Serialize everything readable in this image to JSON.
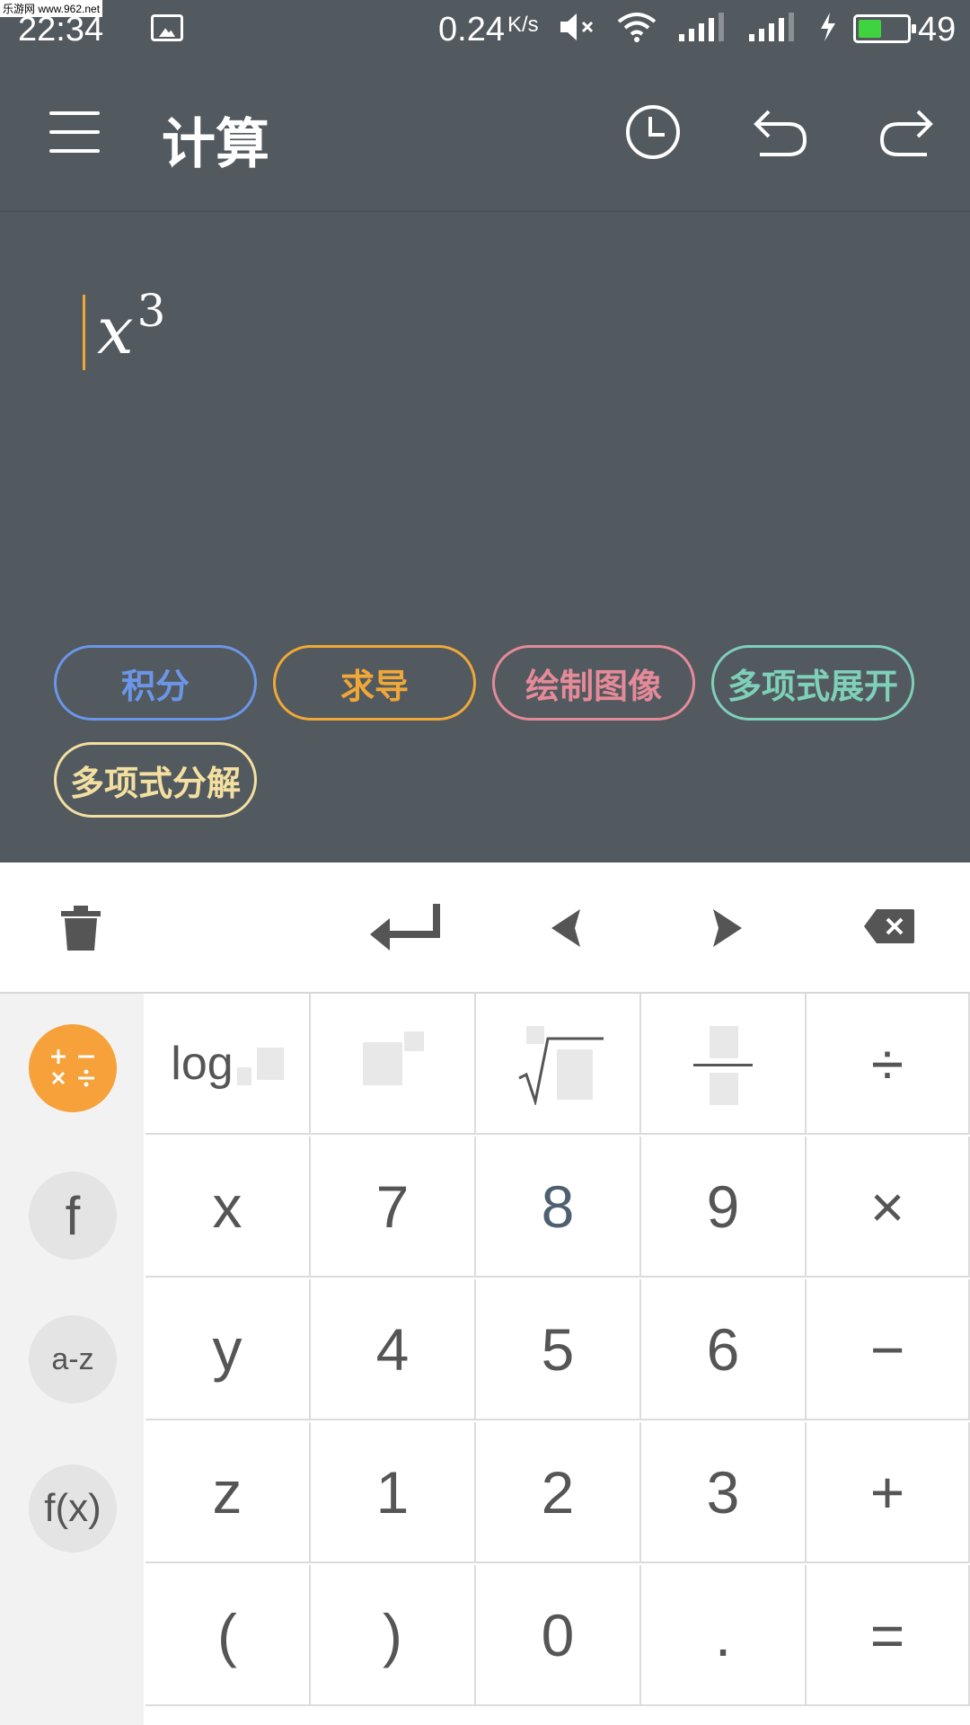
{
  "status_bar": {
    "time": "22:34",
    "speed": "0.24",
    "speed_unit": "K/s",
    "battery_level": "49",
    "battery_fraction": 0.49
  },
  "watermark": "乐游网 www.962.net",
  "app_bar": {
    "title": "计算",
    "icons": [
      "menu-icon",
      "history-icon",
      "undo-icon",
      "redo-icon"
    ]
  },
  "editor": {
    "expression_base": "x",
    "expression_exponent": "3"
  },
  "actions": [
    {
      "label": "积分",
      "color": "#6b96e8"
    },
    {
      "label": "求导",
      "color": "#f0a838"
    },
    {
      "label": "绘制图像",
      "color": "#e58a98"
    },
    {
      "label": "多项式展开",
      "color": "#7fd0b8"
    },
    {
      "label": "多项式分解",
      "color": "#f3e0a0"
    }
  ],
  "toolbar_icons": [
    "trash-icon",
    "enter-icon",
    "left-arrow-icon",
    "right-arrow-icon",
    "backspace-icon"
  ],
  "side_modes": [
    {
      "label": "+ −\n× ÷",
      "icon": "arithmetic-mode-icon",
      "active": true
    },
    {
      "label": "f",
      "icon": "function-mode-icon",
      "active": false
    },
    {
      "label": "a-z",
      "icon": "letters-mode-icon",
      "active": false
    },
    {
      "label": "f(x)",
      "icon": "fx-mode-icon",
      "active": false
    }
  ],
  "keypad": {
    "row1": {
      "log": "log",
      "divide": "÷"
    },
    "row2": [
      "x",
      "7",
      "8",
      "9",
      "×"
    ],
    "row3": [
      "y",
      "4",
      "5",
      "6",
      "−"
    ],
    "row4": [
      "z",
      "1",
      "2",
      "3",
      "+"
    ],
    "row5": [
      "(",
      ")",
      "0",
      ".",
      "="
    ]
  }
}
